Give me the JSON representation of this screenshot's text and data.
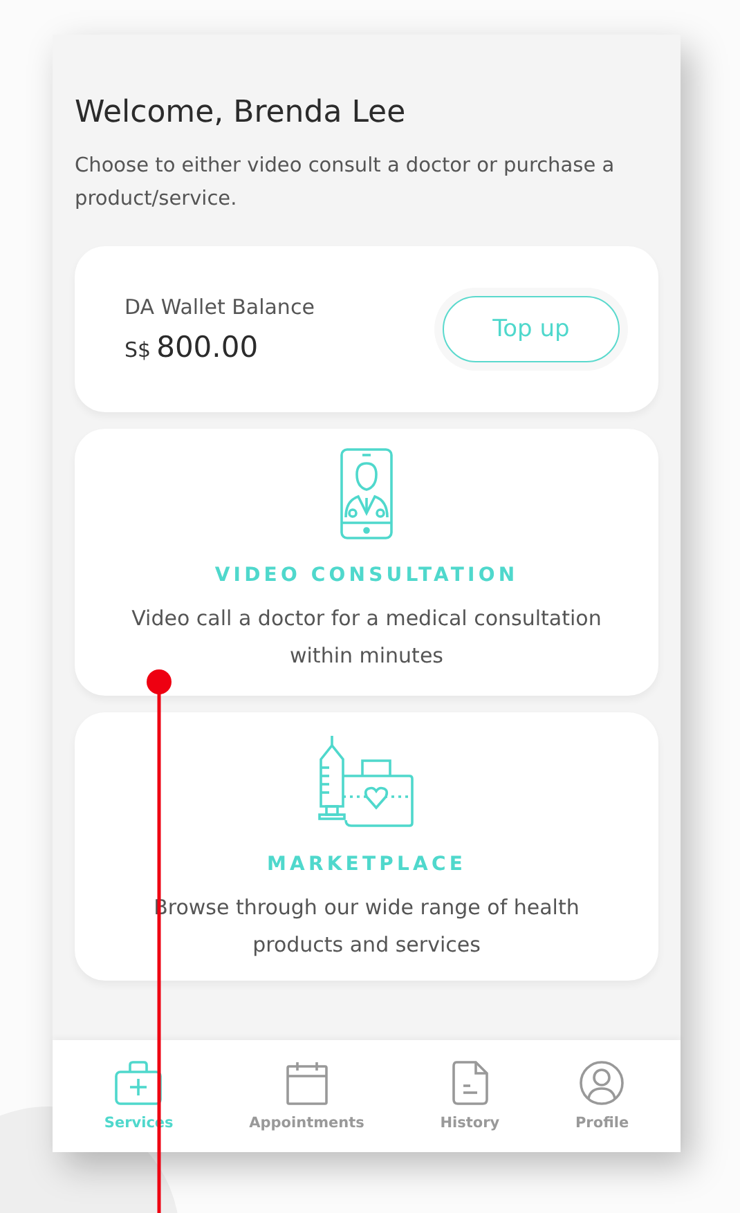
{
  "greeting": {
    "title": "Welcome, Brenda Lee",
    "subtitle": "Choose to either video consult a doctor or purchase a product/service."
  },
  "wallet": {
    "label": "DA Wallet Balance",
    "currency": "S$",
    "amount": "800.00",
    "button": "Top up"
  },
  "services": [
    {
      "kind": "video",
      "title": "VIDEO CONSULTATION",
      "description": "Video call a doctor for a medical consultation within minutes"
    },
    {
      "kind": "market",
      "title": "MARKETPLACE",
      "description": "Browse through our wide range of health products and services"
    }
  ],
  "nav": [
    {
      "kind": "services",
      "label": "Services",
      "selected": true
    },
    {
      "kind": "appointments",
      "label": "Appointments",
      "selected": false
    },
    {
      "kind": "history",
      "label": "History",
      "selected": false
    },
    {
      "kind": "profile",
      "label": "Profile",
      "selected": false
    }
  ]
}
